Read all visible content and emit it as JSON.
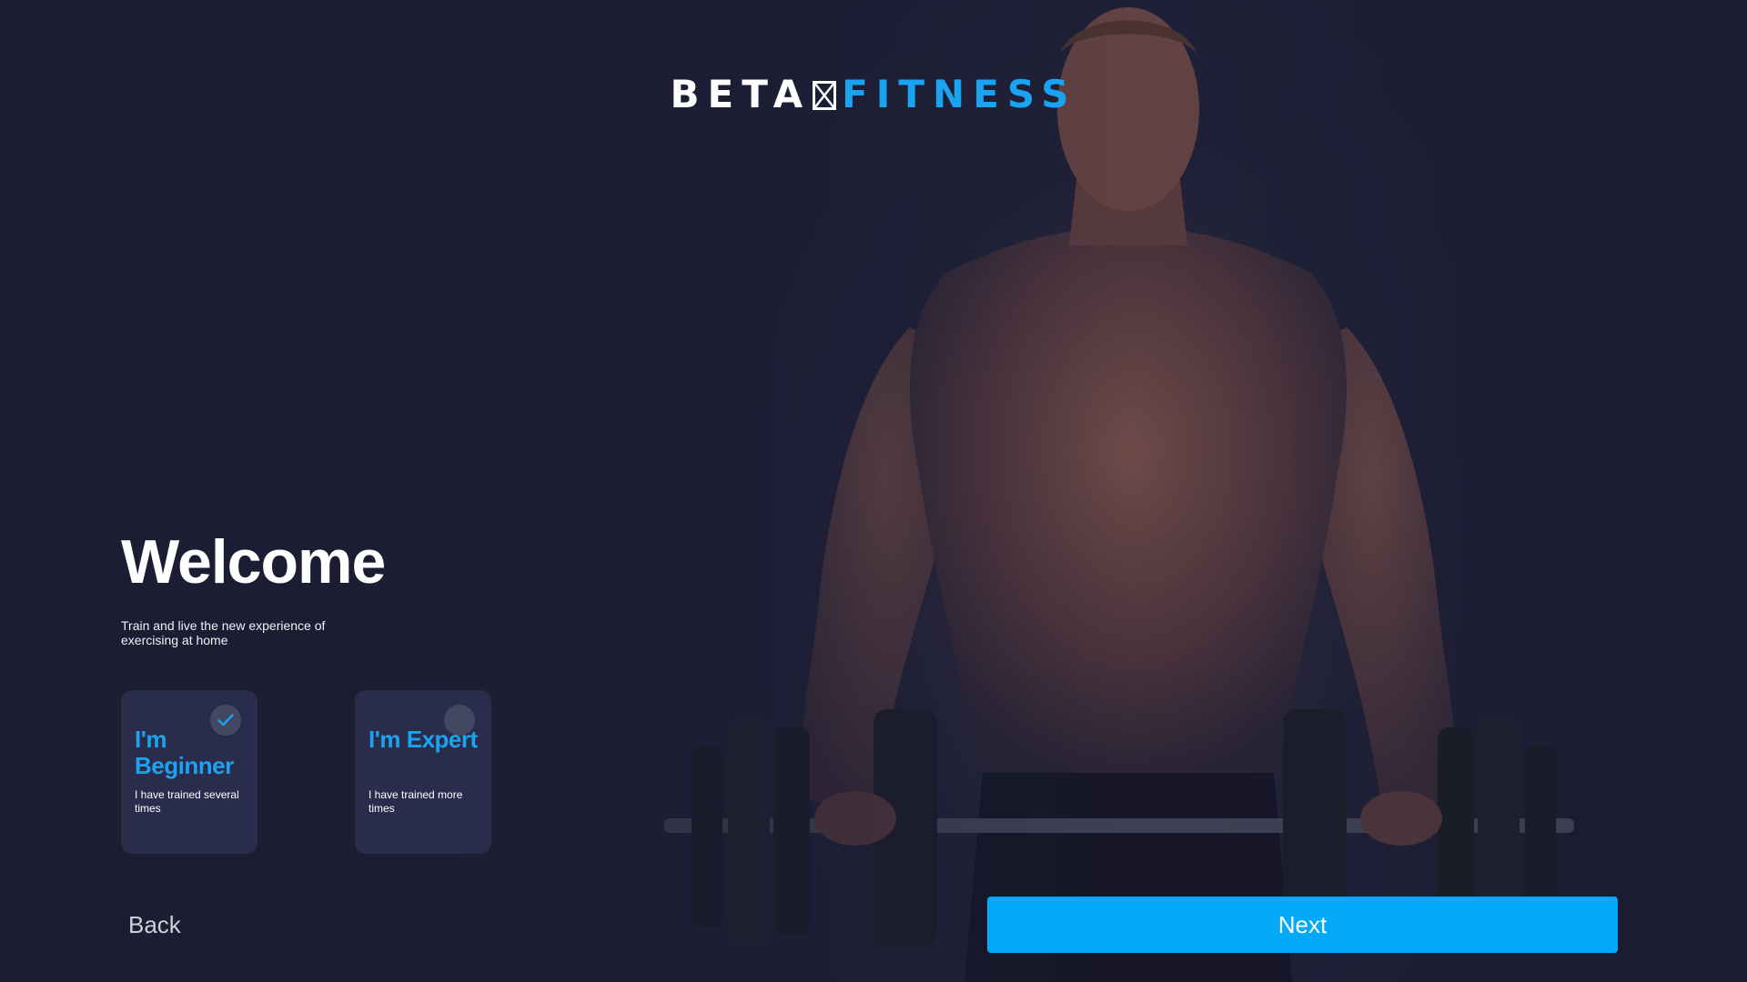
{
  "logo": {
    "word_left": "BETA",
    "word_right": "FITNESS",
    "mark_icon": "box-cross-icon"
  },
  "welcome": {
    "title": "Welcome",
    "subtitle": "Train and live the new experience of exercising at home"
  },
  "levels": [
    {
      "title": "I'm Beginner",
      "description": "I have trained several times",
      "selected": true,
      "icon": "check-icon"
    },
    {
      "title": "I'm Expert",
      "description": "I have trained more times",
      "selected": false,
      "icon": "radio-empty-icon"
    }
  ],
  "nav": {
    "back_label": "Back",
    "next_label": "Next"
  },
  "colors": {
    "background": "#1b1d33",
    "accent": "#1aa3f0",
    "button": "#03a9f9",
    "card": "#2a2c4c"
  },
  "hero_image": "man-lifting-dumbbells-photo"
}
